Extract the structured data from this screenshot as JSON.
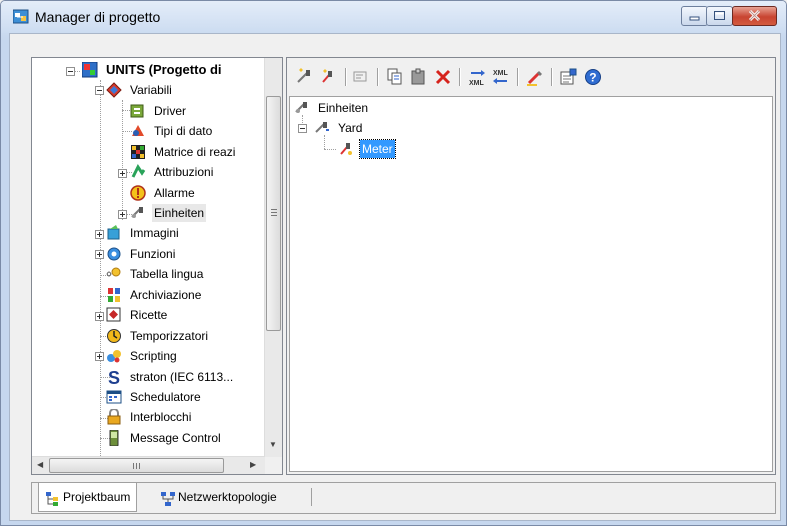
{
  "window": {
    "title": "Manager di progetto"
  },
  "tree": {
    "root_label": "UNITS (Progetto di",
    "items": [
      {
        "label": "Variabili"
      },
      {
        "label": "Driver"
      },
      {
        "label": "Tipi di dato"
      },
      {
        "label": "Matrice di reazi"
      },
      {
        "label": "Attribuzioni"
      },
      {
        "label": "Allarme"
      },
      {
        "label": "Einheiten"
      },
      {
        "label": "Immagini"
      },
      {
        "label": "Funzioni"
      },
      {
        "label": "Tabella lingua"
      },
      {
        "label": "Archiviazione"
      },
      {
        "label": "Ricette"
      },
      {
        "label": "Temporizzatori"
      },
      {
        "label": "Scripting"
      },
      {
        "label": "straton (IEC 6113..."
      },
      {
        "label": "Schedulatore"
      },
      {
        "label": "Interblocchi"
      },
      {
        "label": "Message Control"
      }
    ]
  },
  "detail": {
    "items": [
      {
        "label": "Einheiten"
      },
      {
        "label": "Yard"
      },
      {
        "label": "Meter"
      }
    ]
  },
  "tabs": [
    {
      "label": "Projektbaum",
      "active": true
    },
    {
      "label": "Netzwerktopologie",
      "active": false
    }
  ],
  "scroll_glyphs": {
    "up": "▲",
    "down": "▼",
    "left": "◀",
    "right": "▶"
  },
  "colors": {
    "selection": "#3399ff",
    "title_gradient_top": "#e4edf9",
    "close_button": "#c84431"
  }
}
